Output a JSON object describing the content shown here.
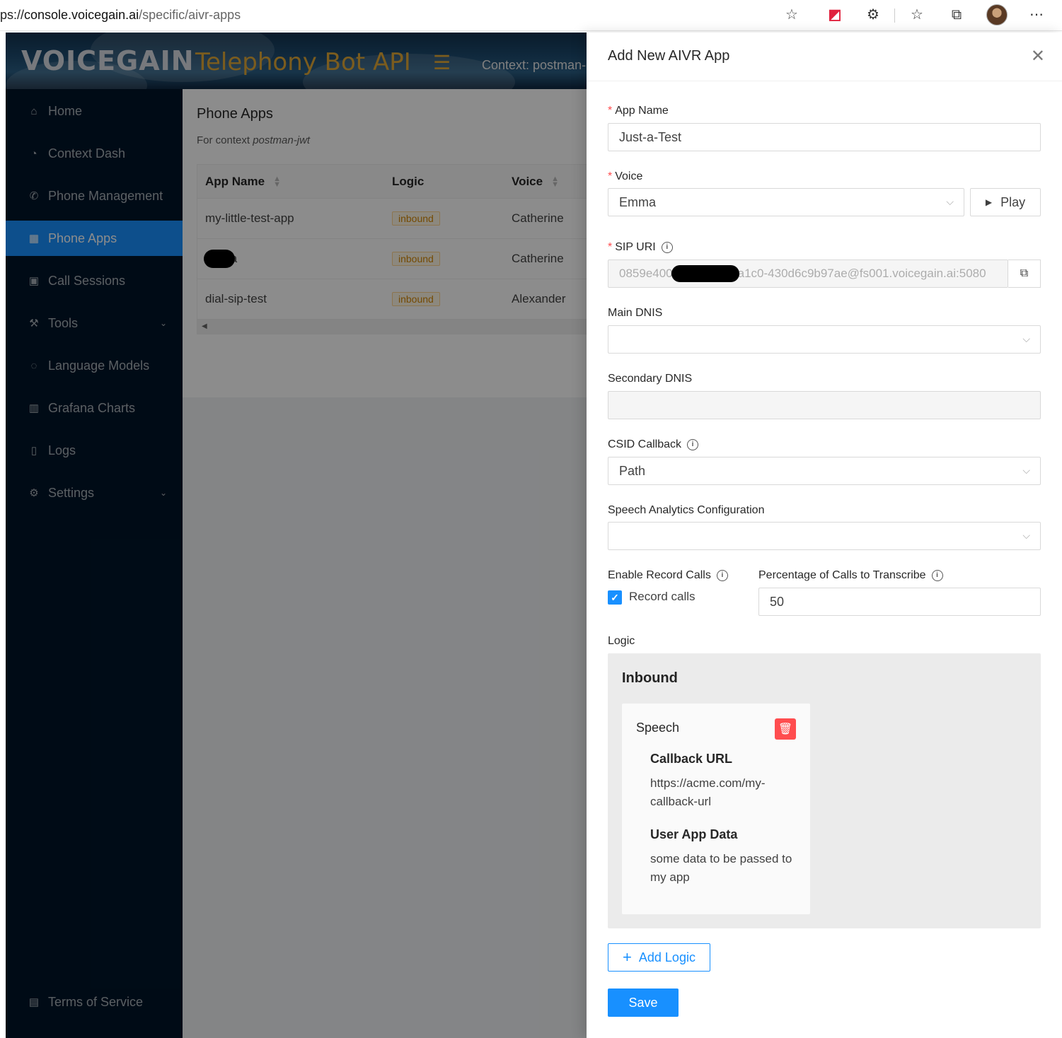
{
  "browser": {
    "url_prefix": "ps://",
    "url_host": "console.voicegain.ai",
    "url_path": "/specific/aivr-apps"
  },
  "header": {
    "logo": "VOICEGAIN",
    "product": "Telephony Bot API",
    "context": "Context:  postman-"
  },
  "sidebar": {
    "items": [
      {
        "label": "Home",
        "icon": "home-icon"
      },
      {
        "label": "Context Dash",
        "icon": "dashboard-icon"
      },
      {
        "label": "Phone Management",
        "icon": "phone-icon"
      },
      {
        "label": "Phone Apps",
        "icon": "table-icon",
        "active": true
      },
      {
        "label": "Call Sessions",
        "icon": "sessions-icon"
      },
      {
        "label": "Tools",
        "icon": "wrench-icon"
      },
      {
        "label": "Language Models",
        "icon": "message-icon"
      },
      {
        "label": "Grafana Charts",
        "icon": "bar-chart-icon"
      },
      {
        "label": "Logs",
        "icon": "file-icon"
      },
      {
        "label": "Settings",
        "icon": "gear-icon"
      }
    ],
    "footer": "Terms of Service"
  },
  "main": {
    "title": "Phone Apps",
    "subtitle_prefix": "For context ",
    "subtitle_context": "postman-jwt",
    "table": {
      "columns": [
        "App Name",
        "Logic",
        "Voice"
      ],
      "rows": [
        {
          "app_name": "my-little-test-app",
          "logic": "inbound",
          "voice": "Catherine"
        },
        {
          "app_name_start": "i",
          "app_name_end": "a",
          "logic": "inbound",
          "voice": "Catherine"
        },
        {
          "app_name": "dial-sip-test",
          "logic": "inbound",
          "voice": "Alexander"
        }
      ]
    }
  },
  "drawer": {
    "title": "Add New AIVR App",
    "app_name_label": "App Name",
    "app_name_value": "Just-a-Test",
    "voice_label": "Voice",
    "voice_value": "Emma",
    "play_label": "Play",
    "sip_uri_label": "SIP URI",
    "sip_uri_start": "0859e400",
    "sip_uri_end": "a1c0-430d6c9b97ae@fs001.voicegain.ai:5080",
    "main_dnis_label": "Main DNIS",
    "main_dnis_value": "",
    "secondary_dnis_label": "Secondary DNIS",
    "csid_callback_label": "CSID Callback",
    "csid_callback_value": "Path",
    "speech_analytics_label": "Speech Analytics Configuration",
    "speech_analytics_value": "",
    "enable_record_label": "Enable Record Calls",
    "record_calls_label": "Record calls",
    "record_calls_checked": true,
    "percentage_label": "Percentage of Calls to Transcribe",
    "percentage_value": "50",
    "logic_label": "Logic",
    "logic": {
      "section_title": "Inbound",
      "card_title": "Speech",
      "callback_url_key": "Callback URL",
      "callback_url_value": "https://acme.com/my-callback-url",
      "user_app_data_key": "User App Data",
      "user_app_data_value": "some data to be passed to my app"
    },
    "add_logic_label": "Add Logic",
    "save_label": "Save"
  },
  "colors": {
    "primary": "#1890ff",
    "sidebar_bg": "#001529",
    "danger": "#ff4d4f",
    "tag_orange": "#d48806",
    "brand_gold": "#e0a838"
  }
}
